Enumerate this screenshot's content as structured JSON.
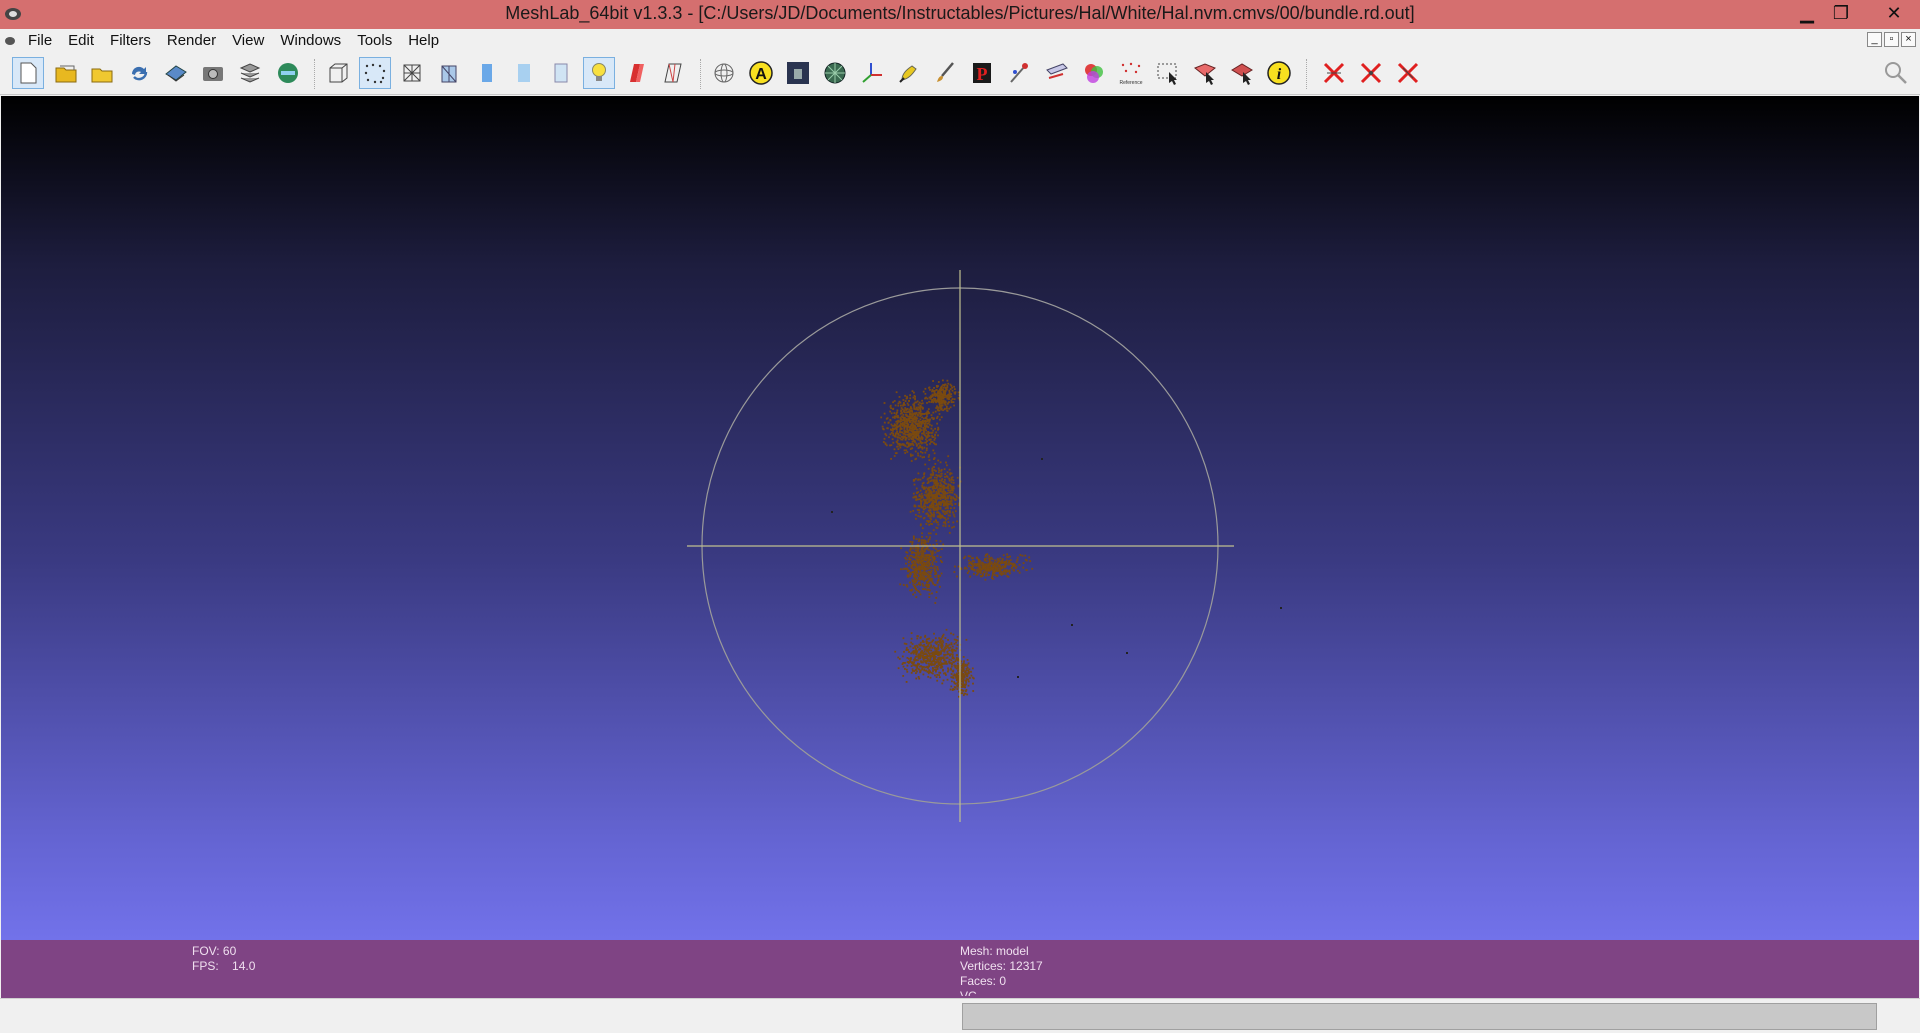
{
  "window": {
    "title": "MeshLab_64bit v1.3.3 - [C:/Users/JD/Documents/Instructables/Pictures/Hal/White/Hal.nvm.cmvs/00/bundle.rd.out]",
    "min_glyph": "▁",
    "max_glyph": "❐",
    "close_glyph": "✕"
  },
  "menu": {
    "items": [
      "File",
      "Edit",
      "Filters",
      "Render",
      "View",
      "Windows",
      "Tools",
      "Help"
    ],
    "mdi_min": "_",
    "mdi_restore": "▫",
    "mdi_close": "×"
  },
  "toolbar": {
    "buttons": [
      {
        "name": "new-project-icon"
      },
      {
        "name": "open-project-icon"
      },
      {
        "name": "import-mesh-icon"
      },
      {
        "name": "reload-icon"
      },
      {
        "name": "export-mesh-icon"
      },
      {
        "name": "snapshot-icon"
      },
      {
        "name": "layers-icon"
      },
      {
        "name": "sketchfab-icon"
      },
      {
        "name": "bbox-icon"
      },
      {
        "name": "points-icon"
      },
      {
        "name": "wireframe-icon"
      },
      {
        "name": "hidden-lines-icon"
      },
      {
        "name": "flat-icon"
      },
      {
        "name": "smooth-icon"
      },
      {
        "name": "texture-icon"
      },
      {
        "name": "light-icon"
      },
      {
        "name": "double-light-icon"
      },
      {
        "name": "backface-icon"
      },
      {
        "name": "trackball-icon"
      },
      {
        "name": "annotation-icon"
      },
      {
        "name": "raster-icon"
      },
      {
        "name": "sphere-icon"
      },
      {
        "name": "axes-icon"
      },
      {
        "name": "paint-icon"
      },
      {
        "name": "brush-icon"
      },
      {
        "name": "pick-points-icon"
      },
      {
        "name": "align-icon"
      },
      {
        "name": "measure-icon"
      },
      {
        "name": "color-icon"
      },
      {
        "name": "reference-icon"
      },
      {
        "name": "select-faces-icon"
      },
      {
        "name": "select-vertices-icon"
      },
      {
        "name": "select-connected-icon"
      },
      {
        "name": "info-icon"
      },
      {
        "name": "delete-faces-icon"
      },
      {
        "name": "delete-vertices-icon"
      },
      {
        "name": "delete-all-icon"
      }
    ],
    "annotation_letter": "A",
    "info_letter": "i",
    "pick_letter": "P",
    "reference_label": "Reference"
  },
  "viewport": {
    "colors": {
      "top": "#000000",
      "bottom": "#7272ea",
      "cloud": "#7a4a10",
      "trackball": "#9a9a9a",
      "axis": "#c0c090"
    }
  },
  "info": {
    "fov_label": "FOV:",
    "fov_value": "60",
    "fps_label": "FPS:",
    "fps_value": "14.0",
    "mesh_line": "Mesh: model",
    "vertices_line": "Vertices: 12317",
    "faces_line": "Faces: 0",
    "vc_line": "VC"
  }
}
